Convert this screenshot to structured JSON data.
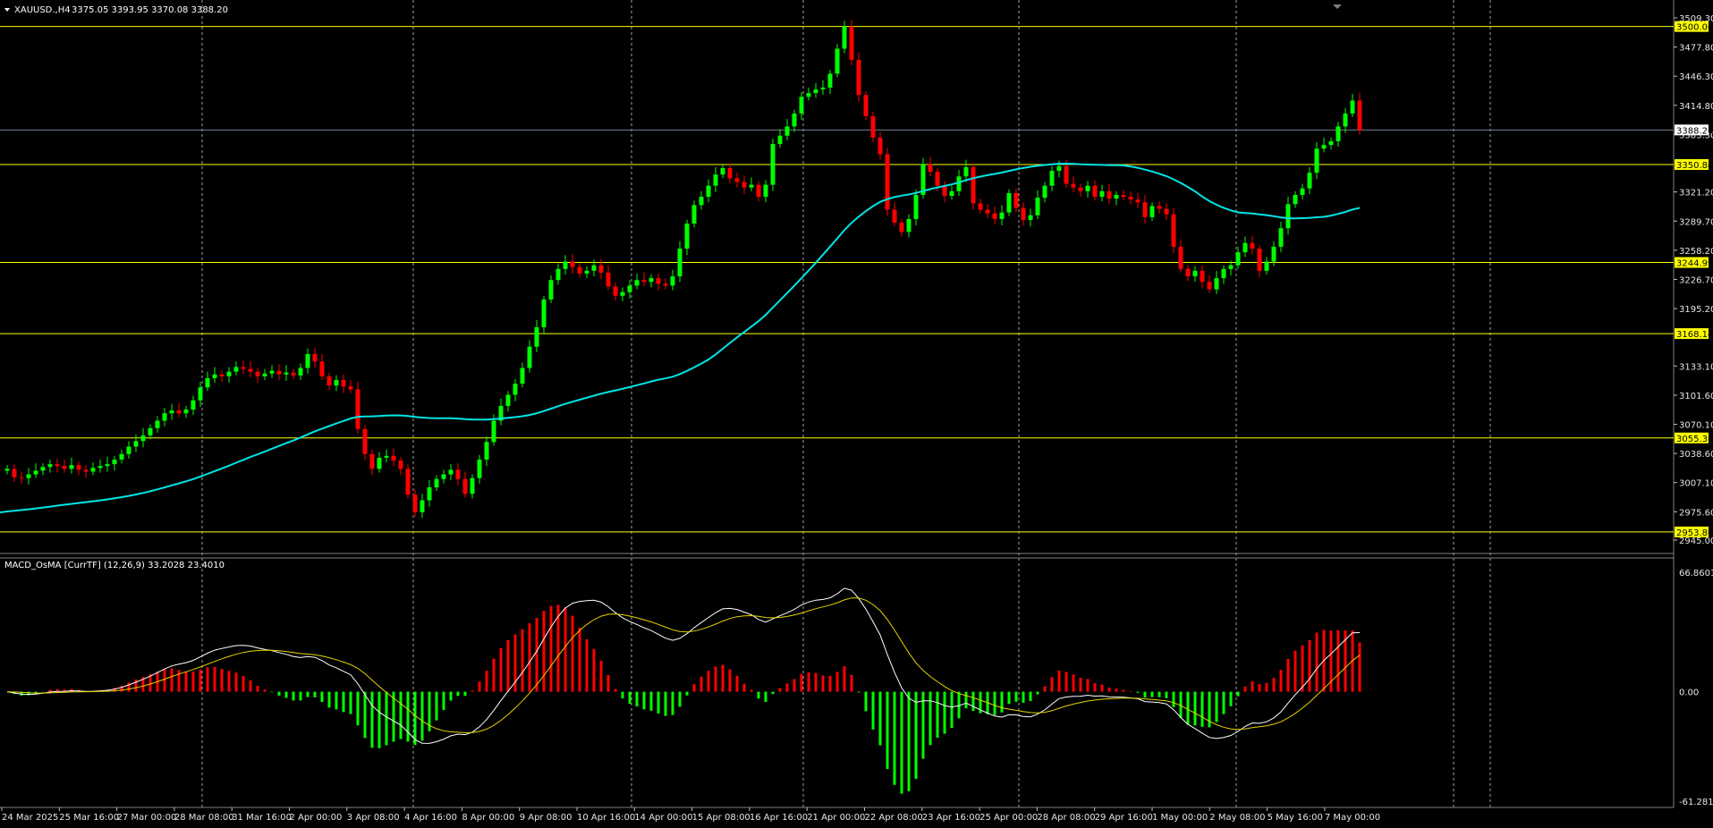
{
  "header": {
    "symbol": "XAUUSD.,H4",
    "ohlc": "3375.05 3393.95 3370.08 3388.20"
  },
  "colors": {
    "background": "#000000",
    "bull": "#00ff00",
    "bear": "#ff0000",
    "level_line": "#ffff00",
    "moving_average": "#00e5e5",
    "macd_line": "#ffffff",
    "signal_line": "#e6d200",
    "grid": "#c8c8c8",
    "current_price": "#708090"
  },
  "price_pane": {
    "current_price": "3388.20",
    "price_labels": [
      "3509.30",
      "3477.80",
      "3446.30",
      "3414.80",
      "3383.30",
      "3321.20",
      "3289.70",
      "3258.20",
      "3226.70",
      "3195.20",
      "3133.10",
      "3101.60",
      "3070.10",
      "3038.60",
      "3007.10",
      "2975.60",
      "2945.00"
    ],
    "levels": [
      "3500.00",
      "3350.84",
      "3244.99",
      "3168.14",
      "3055.38",
      "2953.80"
    ]
  },
  "indicator_pane": {
    "title": "MACD_OsMA [CurrTF] (12,26,9) 33.2028 23.4010",
    "labels": [
      "66.8601",
      "0.00",
      "-61.2811"
    ]
  },
  "time_axis": {
    "labels": [
      "24 Mar 2025",
      "25 Mar 16:00",
      "27 Mar 00:00",
      "28 Mar 08:00",
      "31 Mar 16:00",
      "2 Apr 00:00",
      "3 Apr 08:00",
      "4 Apr 16:00",
      "8 Apr 00:00",
      "9 Apr 08:00",
      "10 Apr 16:00",
      "14 Apr 00:00",
      "15 Apr 08:00",
      "16 Apr 16:00",
      "21 Apr 00:00",
      "22 Apr 08:00",
      "23 Apr 16:00",
      "25 Apr 00:00",
      "28 Apr 08:00",
      "29 Apr 16:00",
      "1 May 00:00",
      "2 May 08:00",
      "5 May 16:00",
      "7 May 00:00"
    ]
  },
  "chart_data": {
    "type": "candlestick",
    "symbol": "XAUUSD.,H4",
    "ylim": [
      2945.0,
      3509.3
    ],
    "close": [
      3022,
      3013,
      3012,
      3016,
      3020,
      3024,
      3027,
      3025,
      3022,
      3026,
      3021,
      3019,
      3023,
      3025,
      3027,
      3032,
      3038,
      3046,
      3052,
      3058,
      3066,
      3074,
      3082,
      3085,
      3082,
      3086,
      3096,
      3110,
      3120,
      3124,
      3122,
      3127,
      3132,
      3130,
      3127,
      3122,
      3125,
      3128,
      3124,
      3126,
      3123,
      3131,
      3146,
      3138,
      3122,
      3112,
      3118,
      3111,
      3108,
      3065,
      3038,
      3022,
      3034,
      3036,
      3031,
      3022,
      2994,
      2975,
      2988,
      3002,
      3011,
      3016,
      3021,
      3011,
      2995,
      3012,
      3032,
      3051,
      3074,
      3090,
      3102,
      3114,
      3131,
      3154,
      3175,
      3205,
      3226,
      3238,
      3246,
      3240,
      3233,
      3236,
      3242,
      3234,
      3219,
      3209,
      3213,
      3220,
      3226,
      3224,
      3228,
      3222,
      3220,
      3230,
      3260,
      3287,
      3307,
      3316,
      3328,
      3340,
      3347,
      3336,
      3332,
      3326,
      3329,
      3316,
      3329,
      3373,
      3382,
      3392,
      3406,
      3424,
      3428,
      3432,
      3434,
      3449,
      3476,
      3500,
      3464,
      3426,
      3403,
      3380,
      3362,
      3302,
      3288,
      3278,
      3292,
      3318,
      3351,
      3343,
      3328,
      3317,
      3322,
      3338,
      3348,
      3309,
      3302,
      3298,
      3292,
      3299,
      3320,
      3304,
      3291,
      3296,
      3315,
      3328,
      3344,
      3349,
      3330,
      3326,
      3322,
      3328,
      3316,
      3322,
      3314,
      3318,
      3316,
      3313,
      3310,
      3294,
      3306,
      3303,
      3297,
      3262,
      3238,
      3230,
      3236,
      3224,
      3216,
      3228,
      3238,
      3242,
      3256,
      3266,
      3260,
      3236,
      3246,
      3262,
      3282,
      3308,
      3318,
      3325,
      3342,
      3368,
      3372,
      3376,
      3392,
      3406,
      3420,
      3388
    ]
  }
}
